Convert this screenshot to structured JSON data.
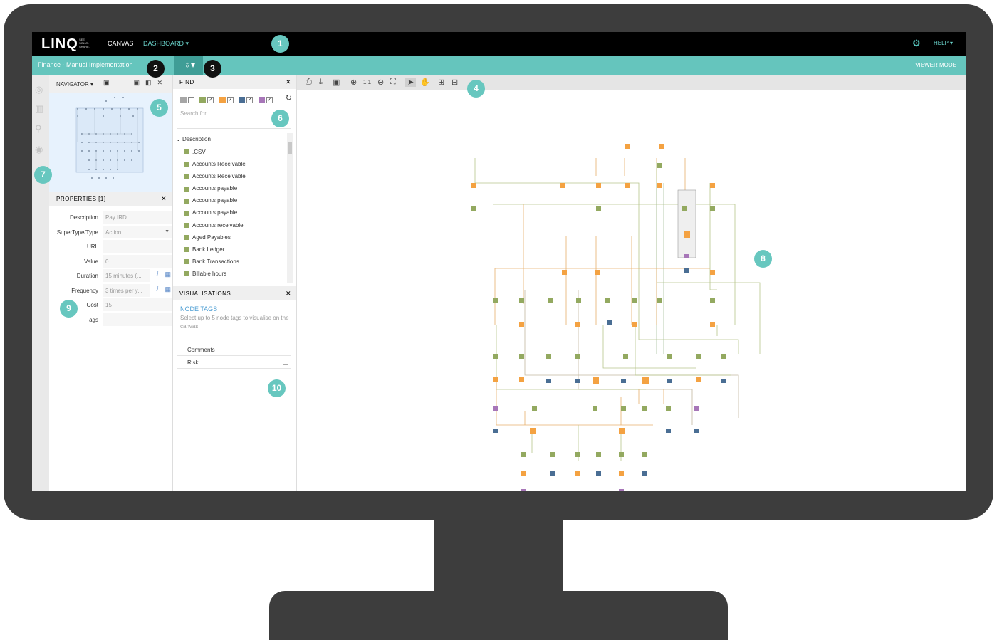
{
  "topbar": {
    "logo": "LINQ",
    "logo_tagline": "SEE. SOLVE. SHARE.",
    "nav": {
      "canvas": "CANVAS",
      "dashboard": "DASHBOARD ▾"
    },
    "help": "HELP ▾"
  },
  "subbar": {
    "title": "Finance - Manual Implementation",
    "user_menu": "♁▾",
    "mode": "VIEWER MODE"
  },
  "navigator": {
    "title": "NAVIGATOR ▾"
  },
  "properties": {
    "title": "PROPERTIES [1]",
    "rows": [
      {
        "label": "Description",
        "value": "Pay IRD"
      },
      {
        "label": "SuperType/Type",
        "value": "Action"
      },
      {
        "label": "URL",
        "value": ""
      },
      {
        "label": "Value",
        "value": "0"
      },
      {
        "label": "Duration",
        "value": "15 minutes (..."
      },
      {
        "label": "Frequency",
        "value": "3 times per y..."
      },
      {
        "label": "Cost",
        "value": "15"
      },
      {
        "label": "Tags",
        "value": ""
      }
    ]
  },
  "find": {
    "title": "FIND",
    "search_placeholder": "Search for...",
    "group_label": "Description",
    "items": [
      ".CSV",
      "Accounts Receivable",
      "Accounts Receivable",
      "Accounts payable",
      "Accounts payable",
      "Accounts payable",
      "Accounts receivable",
      "Aged Payables",
      "Bank Ledger",
      "Bank Transactions",
      "Billable hours"
    ],
    "swatch_colors": [
      "#a6a6a6",
      "#93a960",
      "#f4a242",
      "#4a6e94",
      "#a776b8"
    ]
  },
  "visualisations": {
    "title": "VISUALISATIONS",
    "subtitle": "NODE TAGS",
    "help": "Select up to 5 node tags to visualise on the canvas",
    "tags": [
      "Comments",
      "Risk"
    ]
  },
  "callouts": [
    "1",
    "2",
    "3",
    "4",
    "5",
    "6",
    "7",
    "8",
    "9",
    "10"
  ],
  "colors": {
    "accent": "#65c5bd",
    "monitor": "#3d3d3d",
    "data_node": "#93a960",
    "process_node": "#f4a242",
    "system_node": "#4a6e94",
    "person_node": "#a776b8"
  }
}
